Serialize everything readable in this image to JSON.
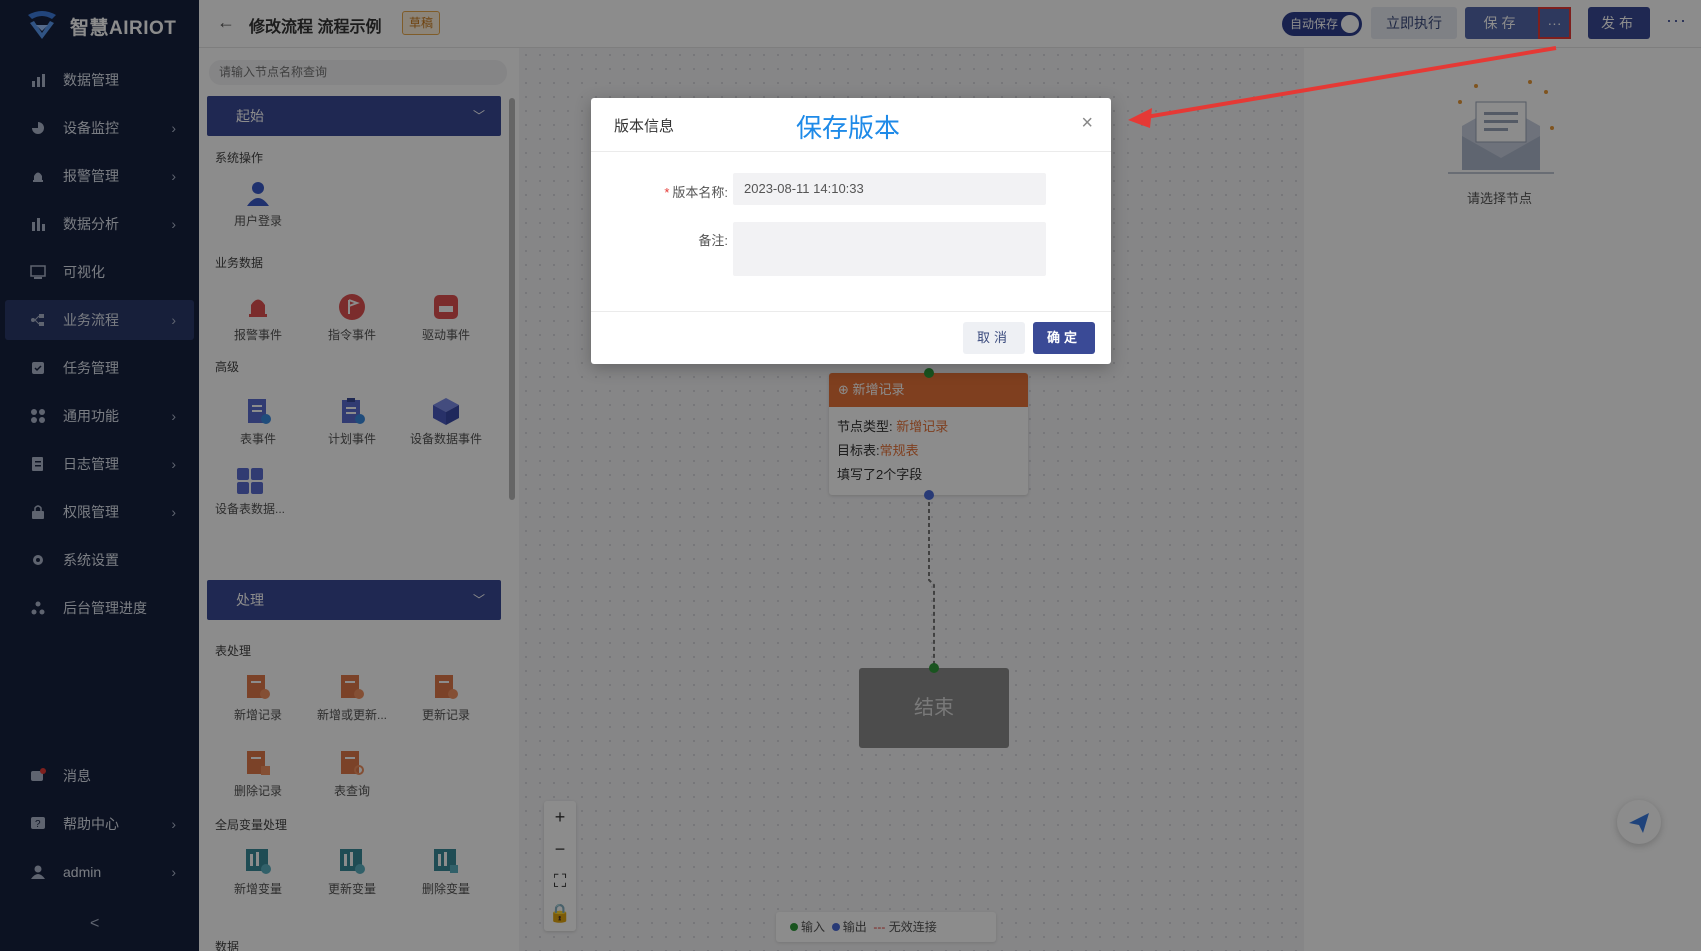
{
  "app": {
    "brand": "智慧AIRIOT"
  },
  "sidebar": {
    "items": [
      {
        "label": "数据管理",
        "icon": "bar-chart-icon",
        "has_children": false
      },
      {
        "label": "设备监控",
        "icon": "dashboard-icon",
        "has_children": true
      },
      {
        "label": "报警管理",
        "icon": "alarm-icon",
        "has_children": true
      },
      {
        "label": "数据分析",
        "icon": "analytics-icon",
        "has_children": true
      },
      {
        "label": "可视化",
        "icon": "monitor-icon",
        "has_children": false
      },
      {
        "label": "业务流程",
        "icon": "flow-icon",
        "has_children": true,
        "active": true
      },
      {
        "label": "任务管理",
        "icon": "task-icon",
        "has_children": false
      },
      {
        "label": "通用功能",
        "icon": "grid-icon",
        "has_children": true
      },
      {
        "label": "日志管理",
        "icon": "log-icon",
        "has_children": true
      },
      {
        "label": "权限管理",
        "icon": "lock-icon",
        "has_children": true
      },
      {
        "label": "系统设置",
        "icon": "gear-icon",
        "has_children": false
      },
      {
        "label": "后台管理进度",
        "icon": "progress-icon",
        "has_children": false
      }
    ],
    "bottom": [
      {
        "label": "消息",
        "icon": "message-icon"
      },
      {
        "label": "帮助中心",
        "icon": "help-icon"
      },
      {
        "label": "admin",
        "icon": "user-icon"
      }
    ],
    "collapse_glyph": "<"
  },
  "header": {
    "back_glyph": "←",
    "title": "修改流程 流程示例",
    "badge": "草稿",
    "autosave_label": "自动保存",
    "run_label": "立即执行",
    "save_label": "保存",
    "more_glyph": "···",
    "publish_label": "发布",
    "overflow_glyph": "⋮"
  },
  "panel": {
    "search_placeholder": "请输入节点名称查询",
    "groups": [
      {
        "title": "起始"
      },
      {
        "title": "处理"
      }
    ],
    "sections": {
      "system_ops": "系统操作",
      "business_data": "业务数据",
      "advanced": "高级",
      "table_processing": "表处理",
      "global_var": "全局变量处理",
      "data": "数据"
    },
    "tiles": {
      "user_login": "用户登录",
      "alarm_event": "报警事件",
      "command_event": "指令事件",
      "driver_event": "驱动事件",
      "table_event": "表事件",
      "plan_event": "计划事件",
      "device_data_event": "设备数据事件",
      "device_table_data": "设备表数据...",
      "add_record": "新增记录",
      "add_or_update": "新增或更新...",
      "update_record": "更新记录",
      "delete_record": "删除记录",
      "table_query": "表查询",
      "add_var": "新增变量",
      "update_var": "更新变量",
      "delete_var": "删除变量"
    }
  },
  "canvas": {
    "node": {
      "title": "新增记录",
      "type_label": "节点类型:",
      "type_value": "新增记录",
      "target_label": "目标表:",
      "target_value": "常规表",
      "fields_text": "填写了2个字段"
    },
    "end_label": "结束",
    "legend": {
      "input": "输入",
      "output": "输出",
      "invalid": "无效连接"
    },
    "empty_text": "请选择节点"
  },
  "modal": {
    "title": "版本信息",
    "annotation": "保存版本",
    "close_glyph": "×",
    "name_label": "版本名称:",
    "name_value": "2023-08-11 14:10:33",
    "note_label": "备注:",
    "note_value": "",
    "cancel_label": "取消",
    "ok_label": "确定"
  },
  "colors": {
    "sidebar_bg": "#16213e",
    "primary": "#3a4a96",
    "node_orange": "#e8743a",
    "annotation_blue": "#1e8ae8",
    "highlight_red": "#e53935",
    "input_dot": "#2e9a3a",
    "output_dot": "#4a6ad8"
  }
}
